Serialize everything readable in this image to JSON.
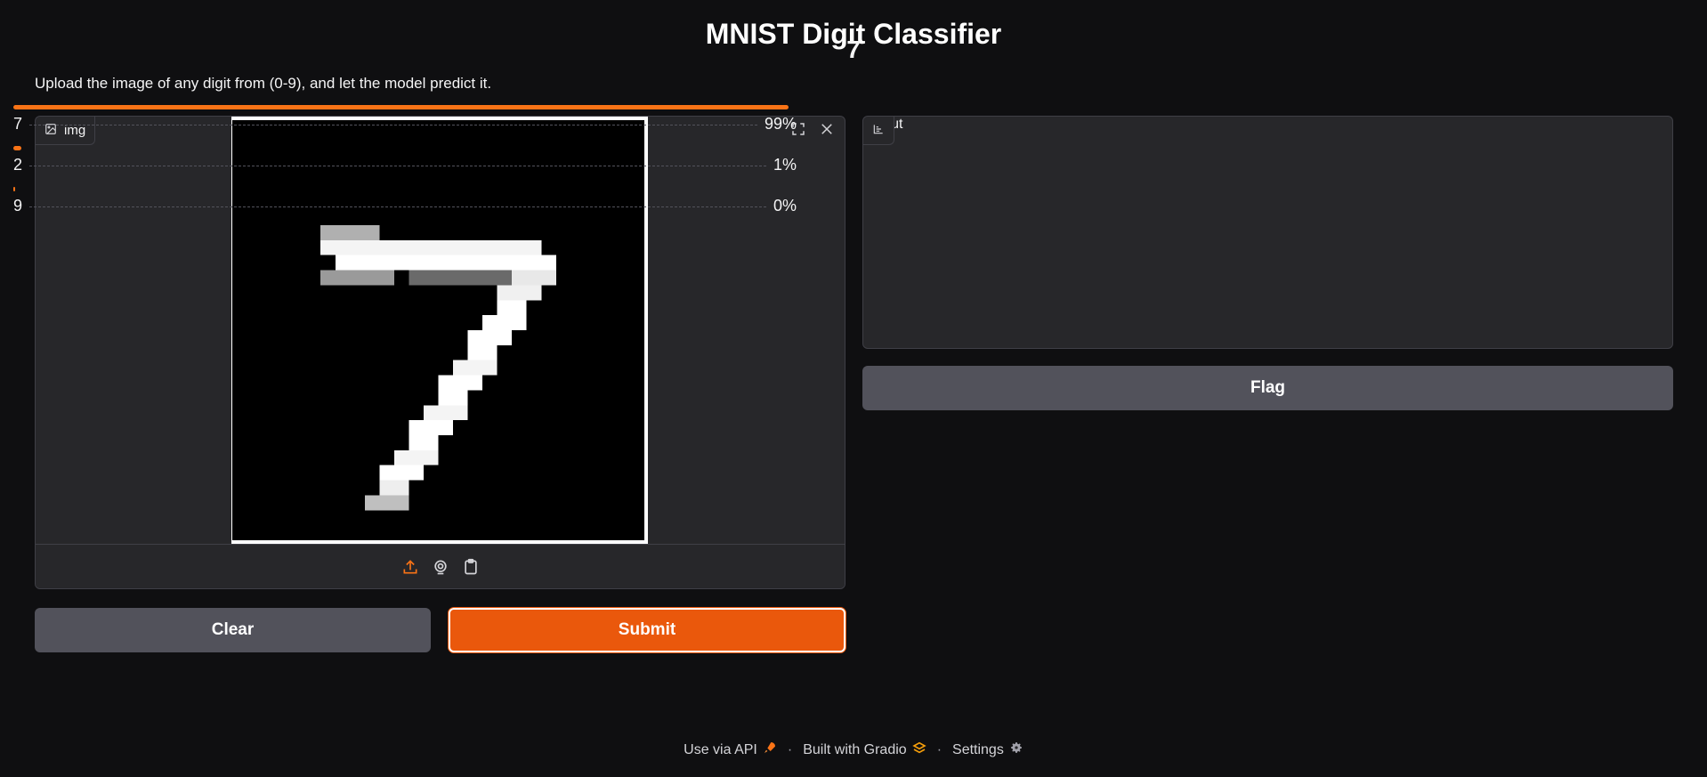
{
  "page": {
    "title": "MNIST Digit Classifier",
    "description": "Upload the image of any digit from (0-9), and let the model predict it."
  },
  "input": {
    "label": "img",
    "icon": "image-icon",
    "toolbar": [
      "fullscreen-icon",
      "close-icon"
    ],
    "sources": [
      "upload-icon",
      "webcam-icon",
      "clipboard-icon"
    ]
  },
  "output": {
    "label": "output",
    "icon": "chart-icon",
    "top_label": "7",
    "confidences": [
      {
        "label": "7",
        "value": 0.99,
        "text": "99%"
      },
      {
        "label": "2",
        "value": 0.01,
        "text": "1%"
      },
      {
        "label": "9",
        "value": 0.002,
        "text": "0%"
      }
    ]
  },
  "buttons": {
    "clear": "Clear",
    "submit": "Submit",
    "flag": "Flag"
  },
  "footer": {
    "api": "Use via API",
    "built": "Built with Gradio",
    "settings": "Settings",
    "separator": "·"
  },
  "colors": {
    "accent": "#ea580c",
    "bar": "#f97316",
    "background": "#0f0f11",
    "panel": "#27272a"
  }
}
